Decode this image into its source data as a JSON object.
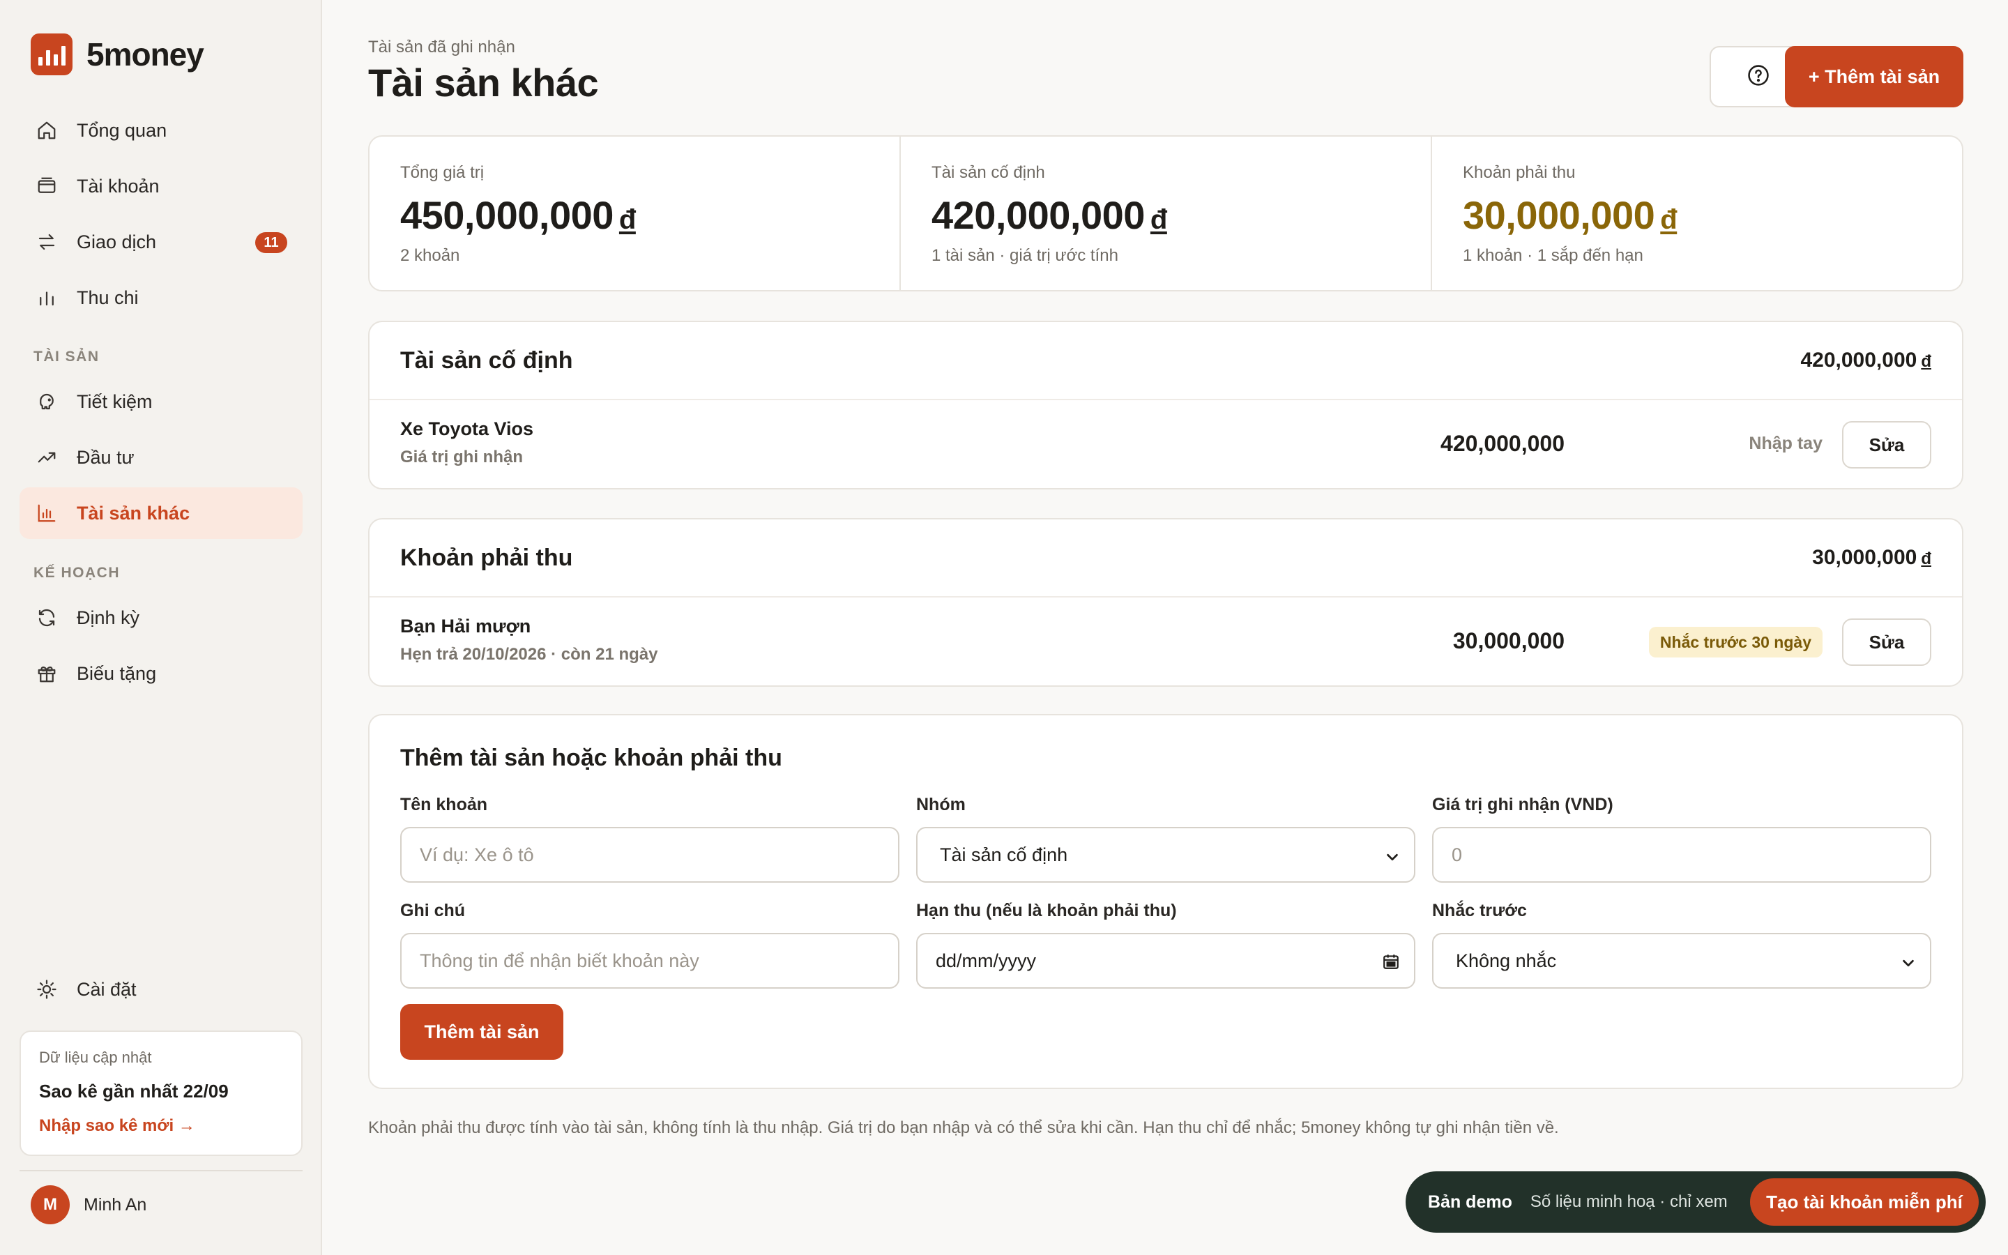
{
  "app": {
    "name": "5money"
  },
  "sidebar": {
    "items": [
      {
        "label": "Tổng quan",
        "icon": "home-icon"
      },
      {
        "label": "Tài khoản",
        "icon": "wallet-icon"
      },
      {
        "label": "Giao dịch",
        "icon": "transfer-icon",
        "badge": "11"
      },
      {
        "label": "Thu chi",
        "icon": "bar-chart-icon"
      }
    ],
    "section_assets": "TÀI SẢN",
    "asset_items": [
      {
        "label": "Tiết kiệm",
        "icon": "piggy-bank-icon"
      },
      {
        "label": "Đầu tư",
        "icon": "trend-up-icon"
      },
      {
        "label": "Tài sản khác",
        "icon": "chart-icon",
        "active": true
      }
    ],
    "section_plan": "KẾ HOẠCH",
    "plan_items": [
      {
        "label": "Định kỳ",
        "icon": "refresh-icon"
      },
      {
        "label": "Biếu tặng",
        "icon": "gift-icon"
      }
    ],
    "settings": {
      "label": "Cài đặt",
      "icon": "sun-gear-icon"
    },
    "data_card": {
      "caption": "Dữ liệu cập nhật",
      "title": "Sao kê gần nhất 22/09",
      "link": "Nhập sao kê mới →"
    },
    "user": {
      "initial": "M",
      "name": "Minh An"
    }
  },
  "header": {
    "eyebrow": "Tài sản đã ghi nhận",
    "title": "Tài sản khác",
    "add_button": "+ Thêm tài sản"
  },
  "summary": [
    {
      "label": "Tổng giá trị",
      "value": "450,000,000",
      "currency": "đ",
      "sub": "2 khoản"
    },
    {
      "label": "Tài sản cố định",
      "value": "420,000,000",
      "currency": "đ",
      "sub": "1 tài sản · giá trị ước tính"
    },
    {
      "label": "Khoản phải thu",
      "value": "30,000,000",
      "currency": "đ",
      "sub": "1 khoản · 1 sắp đến hạn"
    }
  ],
  "fixed_assets": {
    "title": "Tài sản cố định",
    "total": "420,000,000",
    "currency": "đ",
    "rows": [
      {
        "name": "Xe Toyota Vios",
        "sub": "Giá trị ghi nhận",
        "amount": "420,000,000",
        "tag": "Nhập tay",
        "edit": "Sửa"
      }
    ]
  },
  "receivables": {
    "title": "Khoản phải thu",
    "total": "30,000,000",
    "currency": "đ",
    "rows": [
      {
        "name": "Bạn Hải mượn",
        "sub": "Hẹn trả 20/10/2026 · còn 21 ngày",
        "amount": "30,000,000",
        "pill": "Nhắc trước 30 ngày",
        "edit": "Sửa"
      }
    ]
  },
  "form": {
    "title": "Thêm tài sản hoặc khoản phải thu",
    "name_label": "Tên khoản",
    "name_placeholder": "Ví dụ: Xe ô tô",
    "group_label": "Nhóm",
    "group_value": "Tài sản cố định",
    "value_label": "Giá trị ghi nhận (VND)",
    "value_placeholder": "0",
    "note_label": "Ghi chú",
    "note_placeholder": "Thông tin để nhận biết khoản này",
    "due_label": "Hạn thu (nếu là khoản phải thu)",
    "due_placeholder": "dd/mm/yyyy",
    "remind_label": "Nhắc trước",
    "remind_value": "Không nhắc",
    "submit": "Thêm tài sản"
  },
  "footnote": "Khoản phải thu được tính vào tài sản, không tính là thu nhập. Giá trị do bạn nhập và có thể sửa khi cần. Hạn thu chỉ để nhắc; 5money không tự ghi nhận tiền về.",
  "demo": {
    "title": "Bản demo",
    "sub": "Số liệu minh hoạ · chỉ xem",
    "cta": "Tạo tài khoản miễn phí"
  },
  "colors": {
    "accent": "#c8451f",
    "gold": "#8a6608",
    "demo_bg": "#223129"
  }
}
